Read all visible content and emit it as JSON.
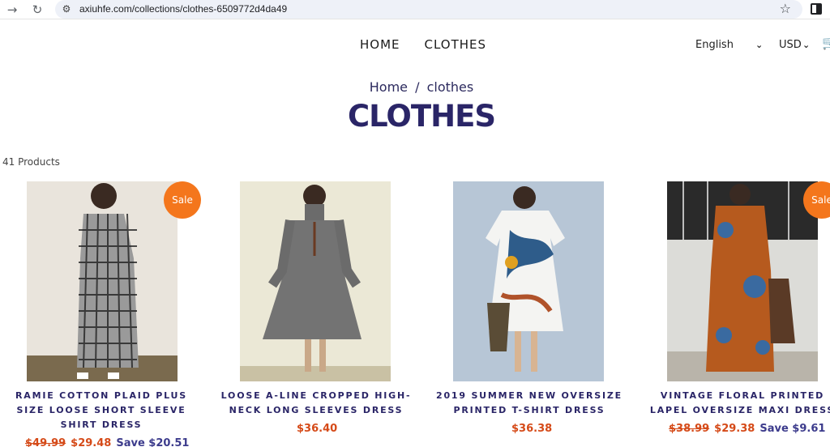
{
  "browser": {
    "url": "axiuhfe.com/collections/clothes-6509772d4da49",
    "back_icon": "arrow-right-icon",
    "reload_icon": "reload-icon",
    "star_icon": "star-icon"
  },
  "nav": {
    "home": "HOME",
    "clothes": "CLOTHES"
  },
  "locale": {
    "language": "English",
    "currency": "USD"
  },
  "breadcrumb": {
    "home": "Home",
    "sep": "/",
    "current": "clothes"
  },
  "page": {
    "title": "CLOTHES",
    "count": "41 Products"
  },
  "colors": {
    "accent": "#2a2567",
    "sale_badge": "#f4761c",
    "price": "#d54a18",
    "save": "#3c3b8c"
  },
  "products": [
    {
      "badge": "Sale",
      "title": "RAMIE COTTON PLAID PLUS SIZE LOOSE SHORT SLEEVE SHIRT DRESS",
      "old_price": "$49.99",
      "price": "$29.48",
      "save": "Save $20.51"
    },
    {
      "badge": "",
      "title": "LOOSE A-LINE CROPPED HIGH-NECK LONG SLEEVES DRESS",
      "old_price": "",
      "price": "$36.40",
      "save": ""
    },
    {
      "badge": "",
      "title": "2019 SUMMER NEW OVERSIZE PRINTED T-SHIRT DRESS",
      "old_price": "",
      "price": "$36.38",
      "save": ""
    },
    {
      "badge": "Sale",
      "title": "VINTAGE FLORAL PRINTED LAPEL OVERSIZE MAXI DRESS",
      "old_price": "$38.99",
      "price": "$29.38",
      "save": "Save $9.61"
    }
  ]
}
